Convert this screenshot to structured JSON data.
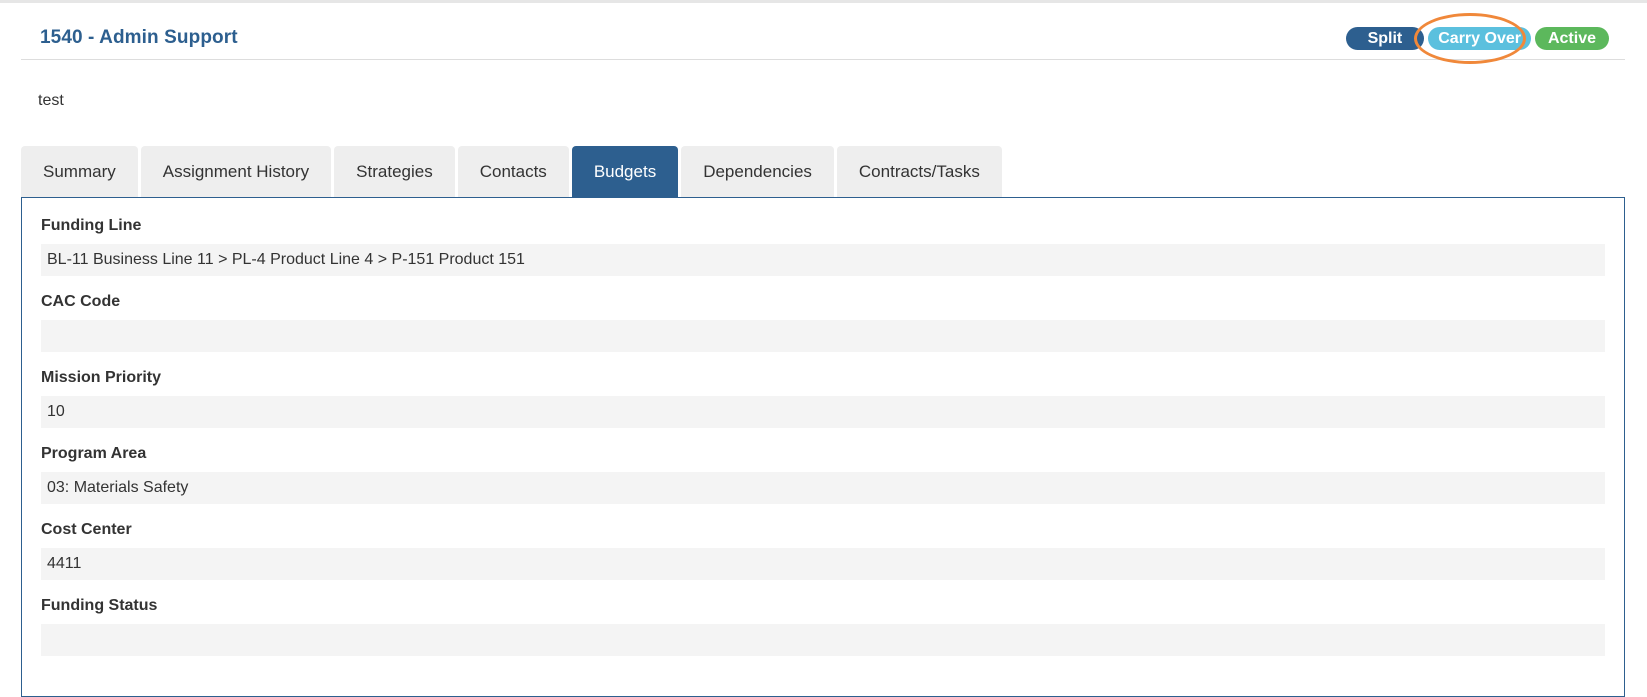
{
  "header": {
    "title": "1540 - Admin Support",
    "badges": {
      "split": "Split",
      "carry_over": "Carry Over",
      "active": "Active"
    }
  },
  "description": "test",
  "tabs": [
    {
      "label": "Summary"
    },
    {
      "label": "Assignment History"
    },
    {
      "label": "Strategies"
    },
    {
      "label": "Contacts"
    },
    {
      "label": "Budgets",
      "active": true
    },
    {
      "label": "Dependencies"
    },
    {
      "label": "Contracts/Tasks"
    }
  ],
  "fields": [
    {
      "label": "Funding Line",
      "value": "BL-11 Business Line 11 > PL-4 Product Line 4 > P-151 Product 151"
    },
    {
      "label": "CAC Code",
      "value": ""
    },
    {
      "label": "Mission Priority",
      "value": "10"
    },
    {
      "label": "Program Area",
      "value": "03: Materials Safety"
    },
    {
      "label": "Cost Center",
      "value": "4411"
    },
    {
      "label": "Funding Status",
      "value": ""
    }
  ],
  "colors": {
    "primary": "#2d5f8f",
    "info": "#5bc0de",
    "success": "#5cb85c",
    "highlight": "#f0883a"
  }
}
